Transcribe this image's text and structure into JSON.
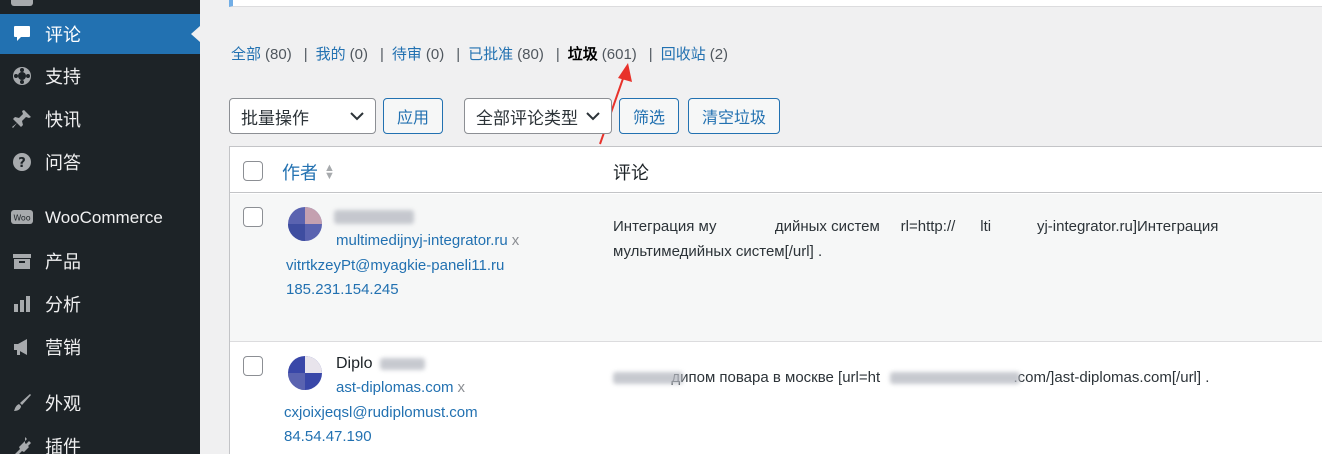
{
  "sidebar": {
    "items": [
      {
        "label": "评论",
        "icon": "speech-bubble-icon",
        "active": true
      },
      {
        "label": "支持",
        "icon": "lifebuoy-icon"
      },
      {
        "label": "快讯",
        "icon": "pushpin-icon"
      },
      {
        "label": "问答",
        "icon": "question-circle-icon"
      },
      {
        "label": "WooCommerce",
        "icon": "woo-icon"
      },
      {
        "label": "产品",
        "icon": "archive-box-icon"
      },
      {
        "label": "分析",
        "icon": "bar-chart-icon"
      },
      {
        "label": "营销",
        "icon": "megaphone-icon"
      },
      {
        "label": "外观",
        "icon": "paintbrush-icon"
      },
      {
        "label": "插件",
        "icon": "plug-icon"
      }
    ]
  },
  "filters": [
    {
      "label": "全部",
      "count": "(80)"
    },
    {
      "label": "我的",
      "count": "(0)"
    },
    {
      "label": "待审",
      "count": "(0)"
    },
    {
      "label": "已批准",
      "count": "(80)"
    },
    {
      "label": "垃圾",
      "count": "(601)",
      "current": true
    },
    {
      "label": "回收站",
      "count": "(2)"
    }
  ],
  "toolbar": {
    "bulk_action": "批量操作",
    "apply": "应用",
    "comment_type": "全部评论类型",
    "filter": "筛选",
    "empty_spam": "清空垃圾"
  },
  "table": {
    "col_author": "作者",
    "col_comment": "评论",
    "rows": [
      {
        "author_name": "",
        "author_url": "multimedijnyj-integrator.ru",
        "remove": "x",
        "email": "vitrtkzeyPt@myagkie-paneli11.ru",
        "ip": "185.231.154.245",
        "comment_line1": "Интеграция му              дийных систем     rl=http://      lti           yj-integrator.ru]Интеграция",
        "comment_line2": "мультимедийных систем[/url] ."
      },
      {
        "author_name": "Diplo",
        "author_url": "ast-diplomas.com",
        "remove": "x",
        "email": "cxjoixjeqsl@rudiplomust.com",
        "ip": "84.54.47.190",
        "comment_line1": "              дипом повара в москве [url=ht                                .com/]ast-diplomas.com[/url] ."
      }
    ]
  },
  "colors": {
    "accent": "#2271b1",
    "sidebar_bg": "#1d2327",
    "arrow": "#e8322b"
  }
}
